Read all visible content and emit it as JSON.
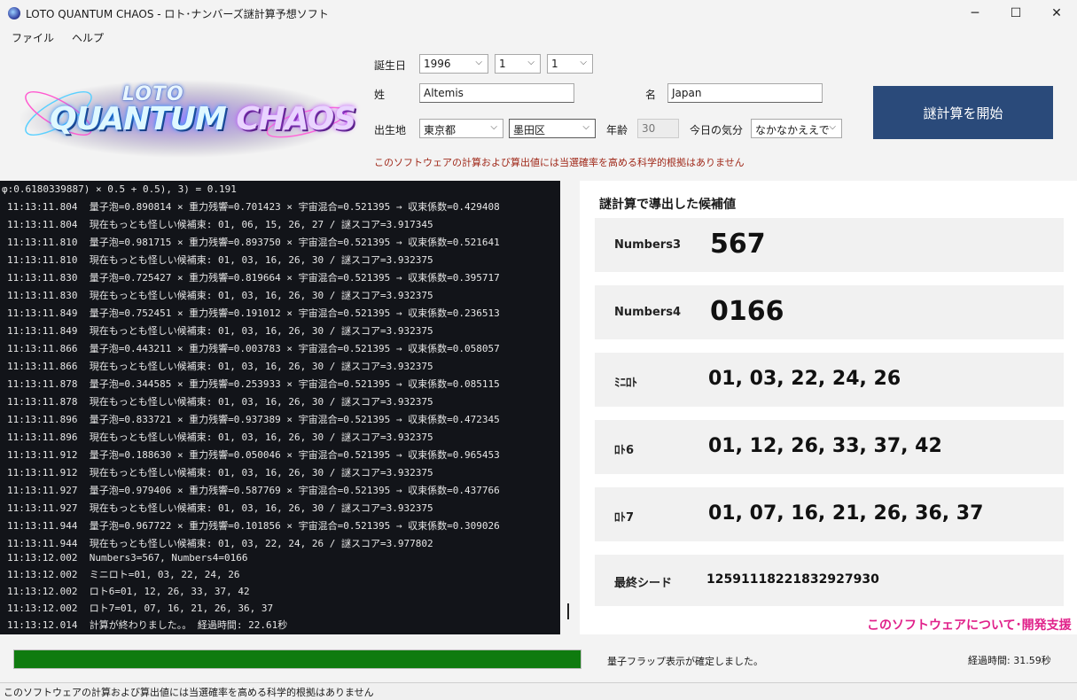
{
  "window": {
    "title": "LOTO QUANTUM CHAOS - ロト･ナンバーズ謎計算予想ソフト",
    "minimize": "─",
    "maximize": "☐",
    "close": "✕"
  },
  "menu": {
    "file": "ファイル",
    "help": "ヘルプ"
  },
  "logo": {
    "loto": "LOTO",
    "quantum": "QUANTUM",
    "chaos": "CHAOS"
  },
  "form": {
    "birthday_label": "誕生日",
    "year": "1996",
    "month": "1",
    "day": "1",
    "surname_label": "姓",
    "surname": "Altemis",
    "name_label": "名",
    "name": "Japan",
    "birthplace_label": "出生地",
    "prefecture": "東京都",
    "city": "墨田区",
    "age_label": "年齢",
    "age": "30",
    "mood_label": "今日の気分",
    "mood": "なかなかええで",
    "disclaimer": "このソフトウェアの計算および算出値には当選確率を高める科学的根拠はありません",
    "start_button": "謎計算を開始"
  },
  "log": [
    "φ:0.6180339887) × 0.5 + 0.5), 3) = 0.191",
    "11:13:11.804  量子泡=0.890814 × 重力残響=0.701423 × 宇宙混合=0.521395 → 収束係数=0.429408",
    "11:13:11.804  現在もっとも怪しい候補束: 01, 06, 15, 26, 27 / 謎スコア=3.917345",
    "11:13:11.810  量子泡=0.981715 × 重力残響=0.893750 × 宇宙混合=0.521395 → 収束係数=0.521641",
    "11:13:11.810  現在もっとも怪しい候補束: 01, 03, 16, 26, 30 / 謎スコア=3.932375",
    "11:13:11.830  量子泡=0.725427 × 重力残響=0.819664 × 宇宙混合=0.521395 → 収束係数=0.395717",
    "11:13:11.830  現在もっとも怪しい候補束: 01, 03, 16, 26, 30 / 謎スコア=3.932375",
    "11:13:11.849  量子泡=0.752451 × 重力残響=0.191012 × 宇宙混合=0.521395 → 収束係数=0.236513",
    "11:13:11.849  現在もっとも怪しい候補束: 01, 03, 16, 26, 30 / 謎スコア=3.932375",
    "11:13:11.866  量子泡=0.443211 × 重力残響=0.003783 × 宇宙混合=0.521395 → 収束係数=0.058057",
    "11:13:11.866  現在もっとも怪しい候補束: 01, 03, 16, 26, 30 / 謎スコア=3.932375",
    "11:13:11.878  量子泡=0.344585 × 重力残響=0.253933 × 宇宙混合=0.521395 → 収束係数=0.085115",
    "11:13:11.878  現在もっとも怪しい候補束: 01, 03, 16, 26, 30 / 謎スコア=3.932375",
    "11:13:11.896  量子泡=0.833721 × 重力残響=0.937389 × 宇宙混合=0.521395 → 収束係数=0.472345",
    "11:13:11.896  現在もっとも怪しい候補束: 01, 03, 16, 26, 30 / 謎スコア=3.932375",
    "11:13:11.912  量子泡=0.188630 × 重力残響=0.050046 × 宇宙混合=0.521395 → 収束係数=0.965453",
    "11:13:11.912  現在もっとも怪しい候補束: 01, 03, 16, 26, 30 / 謎スコア=3.932375",
    "11:13:11.927  量子泡=0.979406 × 重力残響=0.587769 × 宇宙混合=0.521395 → 収束係数=0.437766",
    "11:13:11.927  現在もっとも怪しい候補束: 01, 03, 16, 26, 30 / 謎スコア=3.932375",
    "11:13:11.944  量子泡=0.967722 × 重力残響=0.101856 × 宇宙混合=0.521395 → 収束係数=0.309026",
    "11:13:11.944  現在もっとも怪しい候補束: 01, 03, 22, 24, 26 / 謎スコア=3.977802",
    "11:13:12.002  Numbers3=567, Numbers4=0166",
    "11:13:12.002  ミニロト=01, 03, 22, 24, 26",
    "11:13:12.002  ロト6=01, 12, 26, 33, 37, 42",
    "11:13:12.002  ロト7=01, 07, 16, 21, 26, 36, 37",
    "11:13:12.014  計算が終わりました。。 経過時間: 22.61秒"
  ],
  "results": {
    "title": "謎計算で導出した候補値",
    "numbers3_label": "Numbers3",
    "numbers3": "567",
    "numbers4_label": "Numbers4",
    "numbers4": "0166",
    "miniloto_label": "ﾐﾆﾛﾄ",
    "miniloto": "01, 03, 22, 24, 26",
    "loto6_label": "ﾛﾄ6",
    "loto6": "01, 12, 26, 33, 37, 42",
    "loto7_label": "ﾛﾄ7",
    "loto7": "01, 07, 16, 21, 26, 36, 37",
    "seed_label": "最終シード",
    "seed": "12591118221832927930",
    "about_link": "このソフトウェアについて･開発支援"
  },
  "progress": {
    "value": 1.0,
    "status": "量子フラップ表示が確定しました。",
    "elapsed": "経過時間: 31.59秒"
  },
  "statusbar": "このソフトウェアの計算および算出値には当選確率を高める科学的根拠はありません",
  "colors": {
    "start_button": "#2a4a7a",
    "progress": "#0f7b0f",
    "console_bg": "#121419",
    "about_link": "#e0218a",
    "disclaimer": "#a0291a"
  }
}
